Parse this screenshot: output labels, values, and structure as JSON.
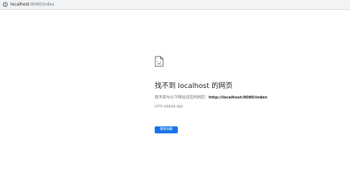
{
  "address_bar": {
    "url_host": "localhost",
    "url_path": ":8080/index",
    "info_icon": "info-icon"
  },
  "error_page": {
    "icon": "sad-page-icon",
    "title": "找不到 localhost 的网页",
    "description_prefix": "找不到与以下网址对应的网页：",
    "description_url": "http://localhost:8080/index",
    "error_code": "HTTP ERROR 404",
    "reload_label": "重新加载"
  },
  "colors": {
    "accent": "#1a73e8",
    "text_primary": "#202124",
    "text_secondary": "#5f6368",
    "address_bar_bg": "#f1f3f4"
  }
}
